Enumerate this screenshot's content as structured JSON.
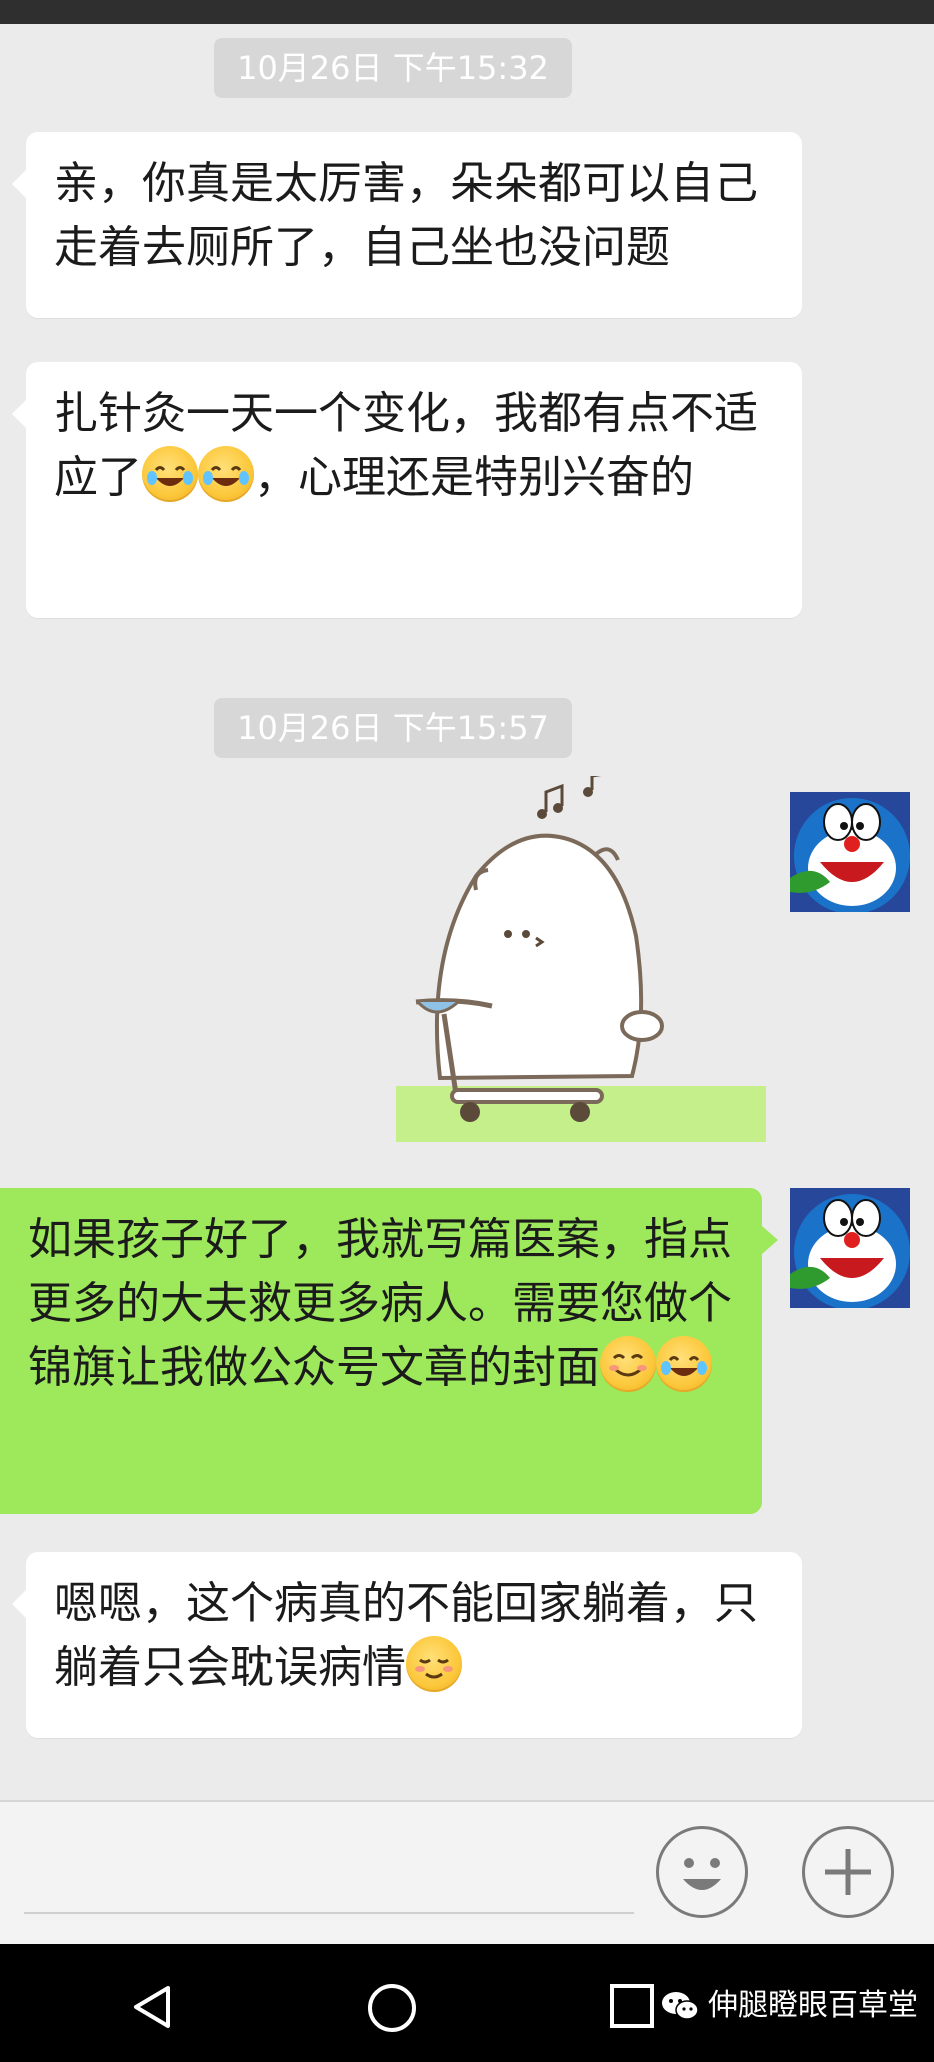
{
  "chat": {
    "timestamps": [
      "10月26日 下午15:32",
      "10月26日 下午15:57"
    ],
    "messages": [
      {
        "text": "亲，你真是太厉害，朵朵都可以自己走着去厕所了，自己坐也没问题"
      },
      {
        "text_1": "扎针灸一天一个变化，我都有点不适应了",
        "emoji_1": "face-with-tears-of-joy",
        "emoji_2": "face-with-tears-of-joy",
        "text_2": "，心理还是特别兴奋的"
      },
      {
        "sticker": "bear-on-scooter-sticker"
      },
      {
        "text_1": "如果孩子好了，我就写篇医案，指点更多的大夫救更多病人。需要您做个锦旗让我做公众号文章的封面",
        "emoji_1": "smiling-face",
        "emoji_2": "face-with-tears-of-joy"
      },
      {
        "text_1": "嗯嗯，这个病真的不能回家躺着，只躺着只会耽误病情",
        "emoji_1": "relieved-face"
      }
    ]
  },
  "avatar": {
    "name": "doraemon-avatar"
  },
  "input": {
    "emoji_button": "smiley-icon",
    "more_button": "plus-icon"
  },
  "nav": {
    "back": "back-triangle-icon",
    "home": "home-circle-icon",
    "recent": "recent-square-icon"
  },
  "watermark": {
    "text": "伸腿瞪眼百草堂"
  },
  "colors": {
    "outgoing_bubble": "#9ee85c",
    "incoming_bubble": "#ffffff",
    "background": "#ebebeb",
    "timestamp_pill": "#d7d7d7"
  }
}
